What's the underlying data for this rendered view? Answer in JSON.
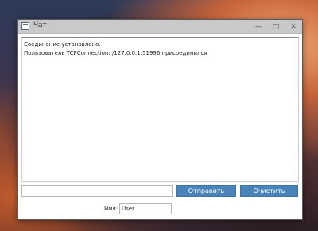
{
  "window": {
    "title": "Чат",
    "icons": {
      "app": "chat-app-icon",
      "minimize": "minimize-icon",
      "maximize": "maximize-icon",
      "close": "close-icon"
    }
  },
  "chat": {
    "lines": [
      "Соединение установлено.",
      "Пользователь TCPConnection: /127.0.0.1:51996 присоединился"
    ]
  },
  "controls": {
    "message_value": "",
    "send_label": "Отправить",
    "clear_label": "Очистить",
    "name_label": "Имя:",
    "name_value": "User"
  },
  "colors": {
    "button": "#4a83b8",
    "button_text": "#ffffff",
    "titlebar": "#c9c9c9"
  }
}
